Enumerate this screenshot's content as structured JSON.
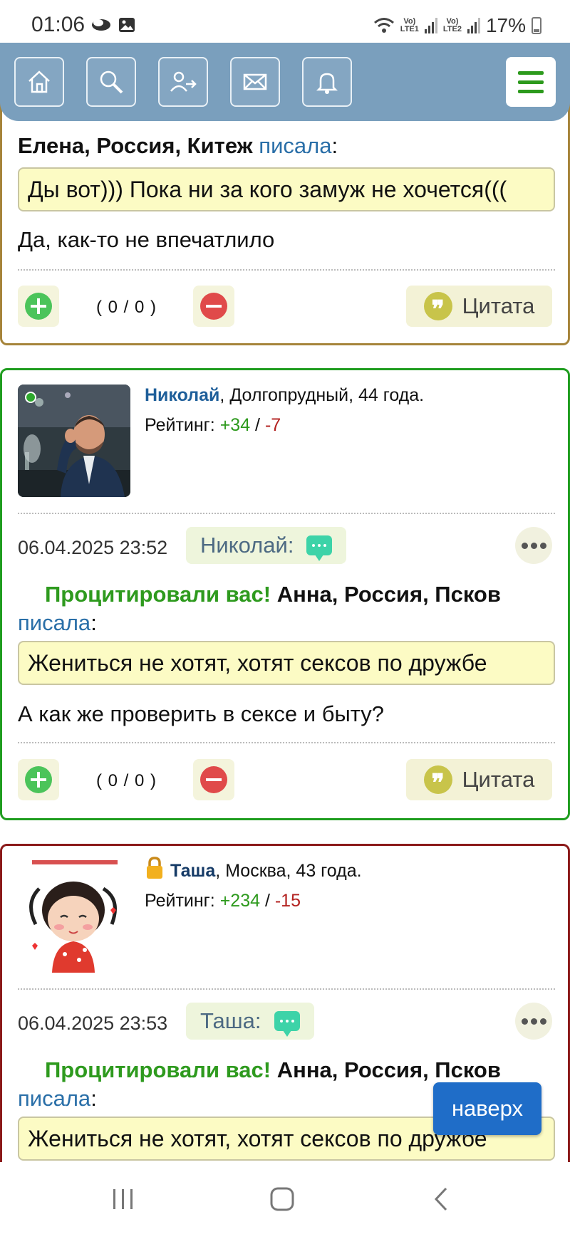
{
  "status": {
    "time": "01:06",
    "battery": "17%",
    "net1": "Vo)\nLTE1",
    "net2": "Vo)\nLTE2",
    "wifi_badge": "6"
  },
  "nav": {
    "buttons": [
      "home-icon",
      "search-icon",
      "logout-icon",
      "mail-icon",
      "bell-icon"
    ],
    "menu": "menu-icon"
  },
  "post1": {
    "quote_author": "Елена, Россия, Китеж",
    "quote_verb": "писала",
    "quote_colon": ":",
    "quote_text": "Ды вот))) Пока ни за кого замуж не хочется(((",
    "message": "Да, как-то не впечатлило",
    "votes": "( 0 / 0 )",
    "cite_label": "Цитата"
  },
  "post2": {
    "username": "Николай",
    "details": ", Долгопрудный, 44 года.",
    "rating_label": "Рейтинг: ",
    "rating_pos": "+34",
    "rating_sep": " / ",
    "rating_neg": "-7",
    "date": "06.04.2025 23:52",
    "reply_label": "Николай:",
    "cited_prefix": "Процитировали вас!",
    "quote_author": "Анна, Россия, Псков",
    "quote_verb": "писала",
    "quote_colon": ":",
    "quote_text": "Жениться не хотят, хотят сексов по дружбе",
    "message": "А как же проверить в сексе и быту?",
    "votes": "( 0 / 0 )",
    "cite_label": "Цитата"
  },
  "post3": {
    "username": "Таша",
    "details": ", Москва, 43 года.",
    "rating_label": "Рейтинг: ",
    "rating_pos": "+234",
    "rating_sep": " / ",
    "rating_neg": "-15",
    "date": "06.04.2025 23:53",
    "reply_label": "Таша:",
    "cited_prefix": "Процитировали вас!",
    "quote_author": "Анна, Россия, Псков",
    "quote_verb": "писала",
    "quote_colon": ":",
    "quote_text": "Жениться не хотят, хотят сексов по дружбе"
  },
  "scroll_top": "наверх"
}
